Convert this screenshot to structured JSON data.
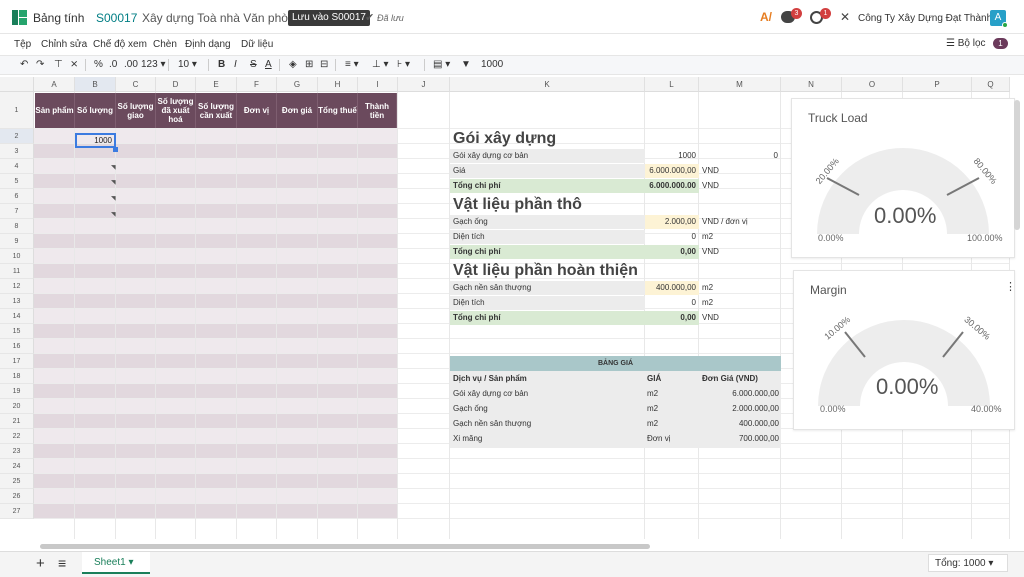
{
  "topbar": {
    "app_title": "Bảng tính",
    "record_id": "S00017",
    "record_name": "Xây dựng Toà nhà Văn phòng",
    "save_label": "Lưu vào S00017",
    "saved_label": "Đã lưu",
    "chat_count": "3",
    "activity_count": "1",
    "company": "Công Ty Xây Dựng Đạt Thành",
    "avatar_letter": "A"
  },
  "menu": [
    "Tệp",
    "Chỉnh sửa",
    "Chế độ xem",
    "Chèn",
    "Định dạng",
    "Dữ liệu"
  ],
  "filter": {
    "label": "Bộ lọc",
    "count": "1"
  },
  "toolbar": {
    "percent": "%",
    "dec_less": ".0",
    "dec_more": ".00",
    "format": "123",
    "font_size": "10",
    "bold": "B",
    "italic": "I",
    "strike": "S",
    "text_color": "A",
    "formula_value": "1000"
  },
  "columns": [
    "A",
    "B",
    "C",
    "D",
    "E",
    "F",
    "G",
    "H",
    "I",
    "J",
    "K",
    "L",
    "M",
    "N",
    "O",
    "P",
    "Q"
  ],
  "rows": [
    "1",
    "2",
    "3",
    "4",
    "5",
    "6",
    "7",
    "8",
    "9",
    "10",
    "11",
    "12",
    "13",
    "14",
    "15",
    "16",
    "17",
    "18",
    "19",
    "20",
    "21",
    "22",
    "23",
    "24",
    "25",
    "26",
    "27"
  ],
  "table_headers": [
    "Sản phẩm",
    "Số lượng",
    "Số lượng giao",
    "Số lượng đã xuất hoá",
    "Số lượng cần xuất",
    "Đơn vị",
    "Đơn giá",
    "Tổng thuế",
    "Thành tiền"
  ],
  "selected_cell_value": "1000",
  "package": {
    "title": "Gói xây dựng",
    "base_label": "Gói xây dựng cơ bản",
    "base_qty": "1000",
    "base_extra": "0",
    "price_label": "Giá",
    "price_value": "6.000.000,00",
    "price_unit": "VND",
    "total_label": "Tổng chi phí",
    "total_value": "6.000.000.00",
    "total_unit": "VND"
  },
  "rough": {
    "title": "Vật liệu phần thô",
    "brick_label": "Gạch ống",
    "brick_value": "2.000,00",
    "brick_unit": "VND / đơn vị",
    "area_label": "Diện tích",
    "area_value": "0",
    "area_unit": "m2",
    "total_label": "Tổng chi phí",
    "total_value": "0,00",
    "total_unit": "VND"
  },
  "finish": {
    "title": "Vật liệu phần hoàn thiện",
    "tile_label": "Gạch nền sân thượng",
    "tile_value": "400.000,00",
    "tile_unit": "m2",
    "area_label": "Diện tích",
    "area_value": "0",
    "area_unit": "m2",
    "total_label": "Tổng chi phí",
    "total_value": "0,00",
    "total_unit": "VND"
  },
  "price_table": {
    "title": "BẢNG GIÁ",
    "headers": [
      "Dịch vụ / Sản phẩm",
      "GIÁ",
      "Đơn Giá (VND)"
    ],
    "rows": [
      [
        "Gói xây dựng cơ bản",
        "m2",
        "6.000.000,00"
      ],
      [
        "Gạch ống",
        "m2",
        "2.000.000,00"
      ],
      [
        "Gạch nền sân thượng",
        "m2",
        "400.000,00"
      ],
      [
        "Xi măng",
        "Đơn vị",
        "700.000,00"
      ]
    ]
  },
  "gauges": [
    {
      "title": "Truck Load",
      "value": "0.00%",
      "min": "0.00%",
      "max": "100.00%",
      "low_tick": "20.00%",
      "high_tick": "80.00%"
    },
    {
      "title": "Margin",
      "value": "0.00%",
      "min": "0.00%",
      "max": "40.00%",
      "low_tick": "10.00%",
      "high_tick": "30.00%"
    }
  ],
  "bottom": {
    "sheet_name": "Sheet1",
    "sum_label": "Tổng: 1000"
  },
  "colors": {
    "header_bg": "#6b4a5d",
    "accent": "#1a7f5a",
    "record": "#017e84"
  }
}
